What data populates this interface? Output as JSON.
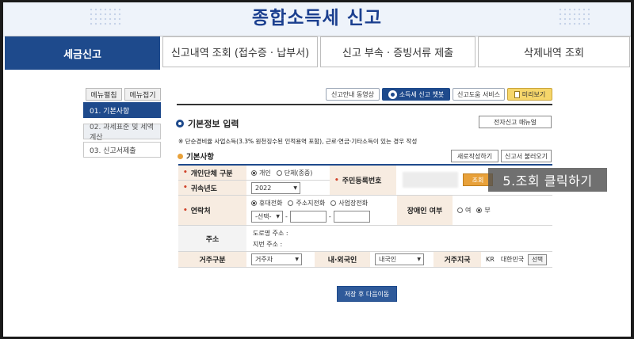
{
  "header": {
    "title": "종합소득세 신고"
  },
  "tabs": [
    {
      "label": "세금신고",
      "active": true
    },
    {
      "label": "신고내역 조회 (접수증 · 납부서)"
    },
    {
      "label": "신고 부속 · 증빙서류 제출"
    },
    {
      "label": "삭제내역 조회"
    }
  ],
  "sidebar": {
    "expand_label": "메뉴펼침",
    "collapse_label": "메뉴접기",
    "items": [
      {
        "label": "01. 기본사항",
        "state": "active"
      },
      {
        "label": "02. 과세표준 및 세액계산",
        "state": "inactive"
      },
      {
        "label": "03. 신고서제출",
        "state": "normal"
      }
    ]
  },
  "toolbar": {
    "video_guide": "신고안내 동영상",
    "chatbot": "소득세 신고 챗봇",
    "help_service": "신고도움 서비스",
    "preview": "미리보기"
  },
  "section": {
    "title": "기본정보 입력",
    "manual_button": "전자신고 매뉴얼",
    "notice": "※ 단순경비율 사업소득(3.3% 원천징수된 인적용역 포함), 근로·연금·기타소득이 있는 경우 작성",
    "subsection": "기본사항",
    "new_button": "새로작성하기",
    "load_button": "신고서 불러오기"
  },
  "form": {
    "taxpayer_type": {
      "label": "개인단체 구분",
      "options": [
        "개인",
        "단체(종중)"
      ],
      "selected": "개인"
    },
    "resident_number": {
      "label": "주민등록번호",
      "lookup_button": "조회"
    },
    "year": {
      "label": "귀속년도",
      "value": "2022"
    },
    "contact": {
      "label": "연락처",
      "options": [
        "휴대전화",
        "주소지전화",
        "사업장전화"
      ],
      "selected": "휴대전화",
      "select_value": "-선택-",
      "dash": "-"
    },
    "disability": {
      "label": "장애인 여부",
      "options": [
        "여",
        "부"
      ],
      "selected": "부"
    },
    "address": {
      "label": "주소",
      "road": "도로명 주소 :",
      "lot": "지번 주소 :"
    },
    "residence_type": {
      "label": "거주구분",
      "value": "거주자"
    },
    "nationality": {
      "label": "내·외국인",
      "value": "내국인"
    },
    "residence_country": {
      "label": "거주지국",
      "code": "KR",
      "name": "대한민국",
      "select_button": "선택"
    }
  },
  "footer": {
    "save_next": "저장 후 다음이동"
  },
  "annotation": {
    "text": "5.조회 클릭하기"
  }
}
